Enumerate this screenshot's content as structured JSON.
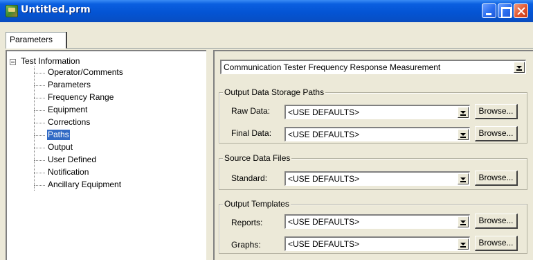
{
  "window": {
    "title": "Untitled.prm"
  },
  "tabs": [
    {
      "label": "Parameters"
    }
  ],
  "tree": {
    "root": "Test Information",
    "items": [
      {
        "label": "Operator/Comments",
        "selected": false
      },
      {
        "label": "Parameters",
        "selected": false
      },
      {
        "label": "Frequency Range",
        "selected": false
      },
      {
        "label": "Equipment",
        "selected": false
      },
      {
        "label": "Corrections",
        "selected": false
      },
      {
        "label": "Paths",
        "selected": true
      },
      {
        "label": "Output",
        "selected": false
      },
      {
        "label": "User Defined",
        "selected": false
      },
      {
        "label": "Notification",
        "selected": false
      },
      {
        "label": "Ancillary Equipment",
        "selected": false
      }
    ]
  },
  "test_type": {
    "value": "Communication Tester Frequency Response Measurement"
  },
  "output_paths": {
    "title": "Output Data Storage Paths",
    "raw": {
      "label": "Raw Data:",
      "value": "<USE DEFAULTS>",
      "browse": "Browse..."
    },
    "final": {
      "label": "Final Data:",
      "value": "<USE DEFAULTS>",
      "browse": "Browse..."
    }
  },
  "source_files": {
    "title": "Source Data Files",
    "standard": {
      "label": "Standard:",
      "value": "<USE DEFAULTS>",
      "browse": "Browse..."
    }
  },
  "templates": {
    "title": "Output Templates",
    "reports": {
      "label": "Reports:",
      "value": "<USE DEFAULTS>",
      "browse": "Browse..."
    },
    "graphs": {
      "label": "Graphs:",
      "value": "<USE DEFAULTS>",
      "browse": "Browse..."
    }
  },
  "icons": {
    "app": "application-icon",
    "minimize": "minimize-icon",
    "maximize": "maximize-icon",
    "close": "close-icon",
    "expander": "tree-collapse-icon",
    "dropdown": "dropdown-arrow-icon"
  },
  "colors": {
    "titlebar": "#0454d4",
    "selection": "#316ac5",
    "close_button": "#e0552f",
    "dialog_bg": "#ece9d8"
  }
}
